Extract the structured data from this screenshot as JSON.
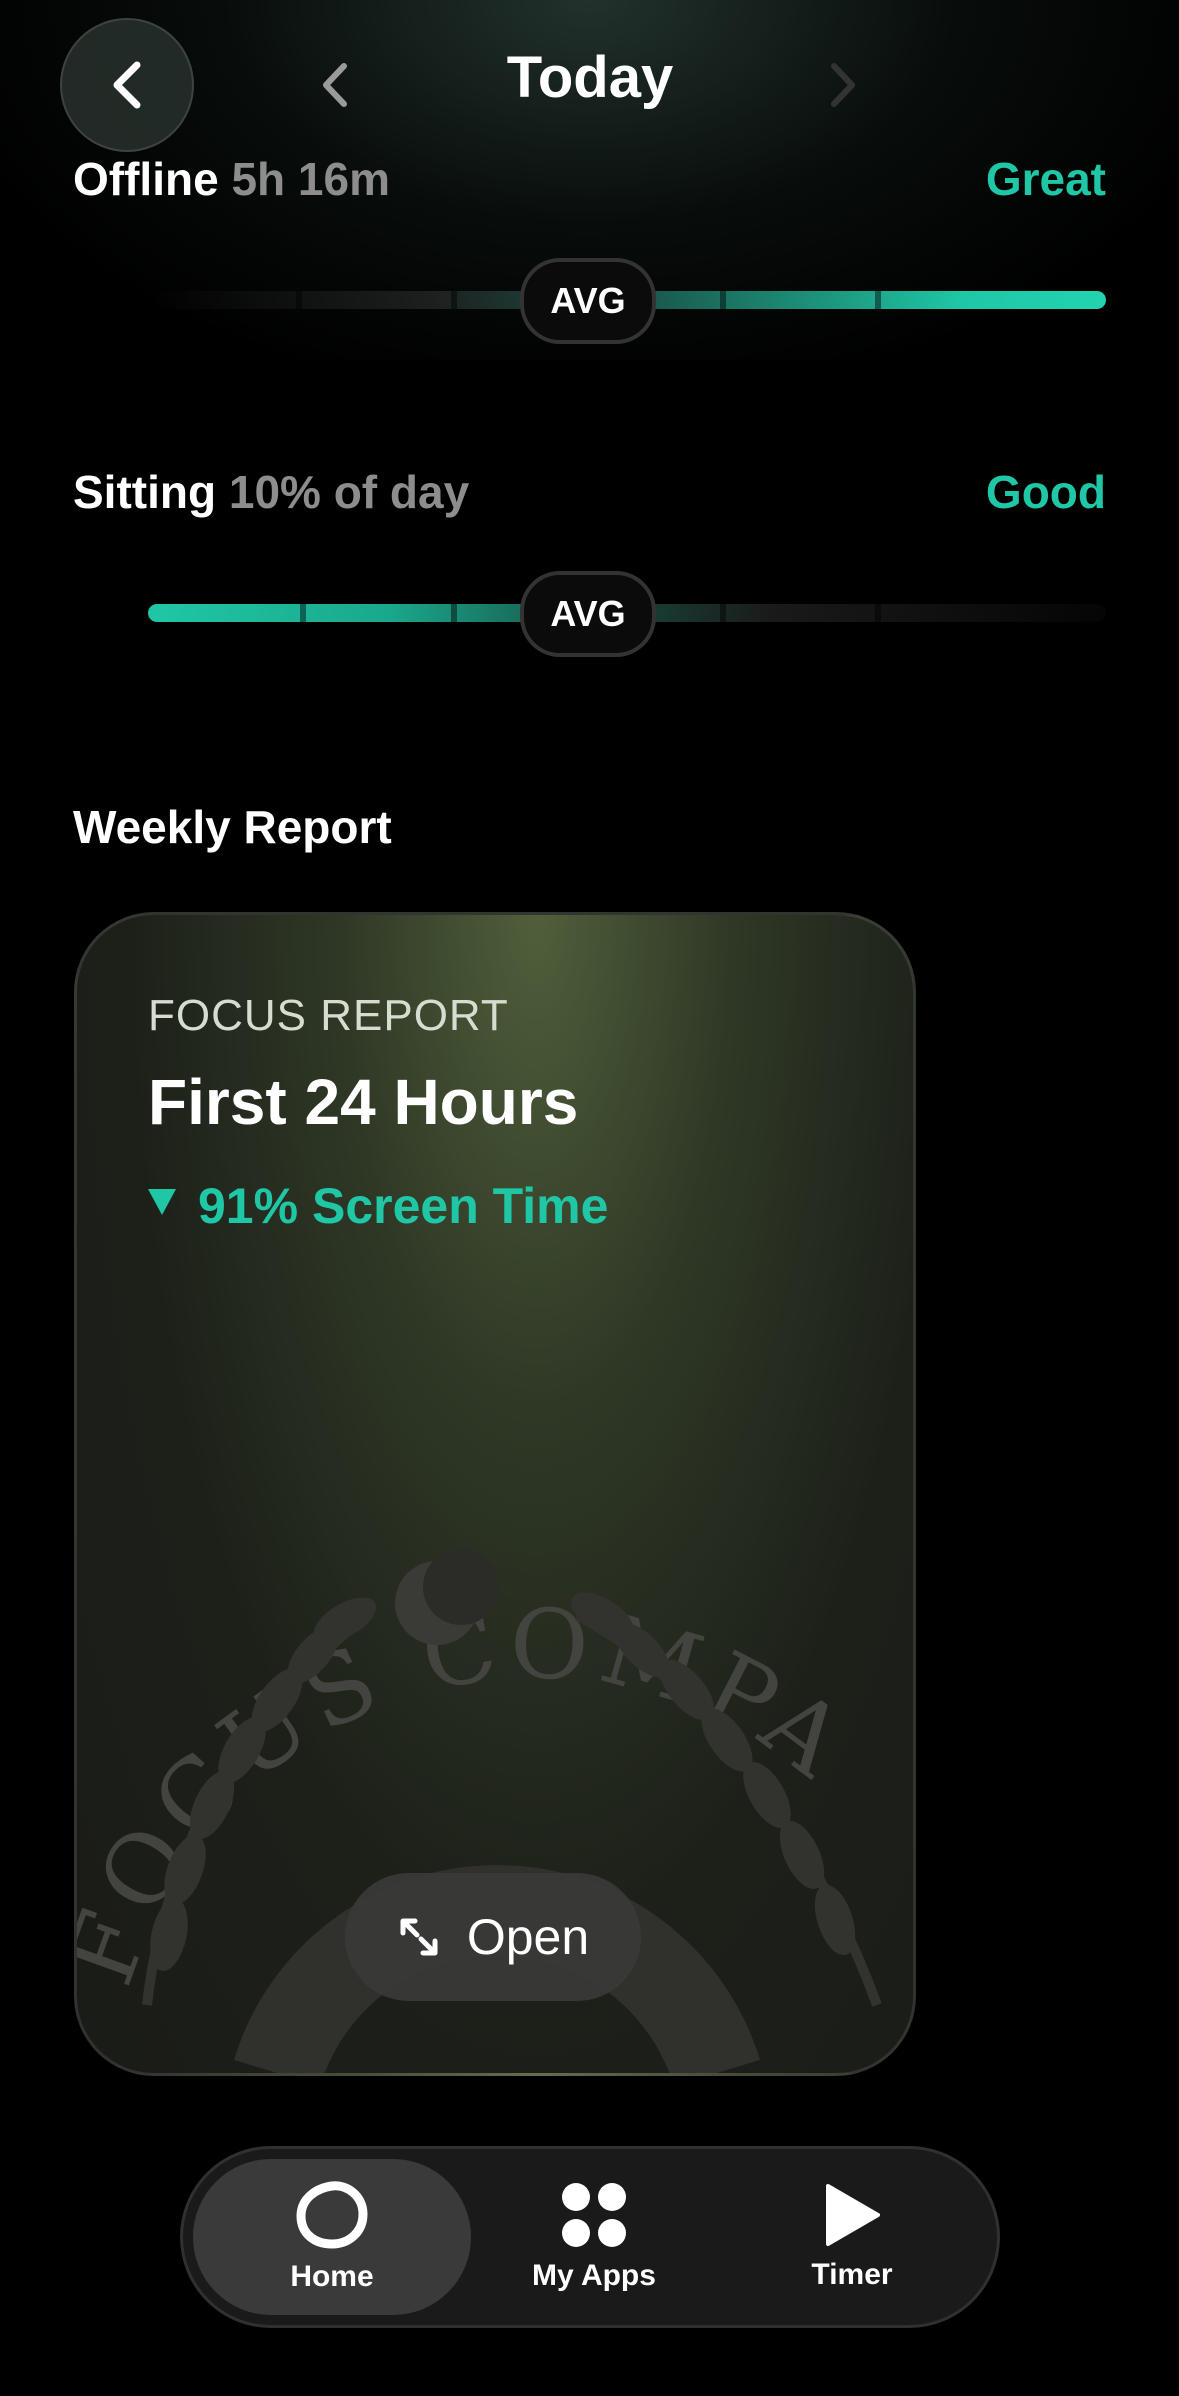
{
  "header": {
    "title": "Today"
  },
  "metrics": [
    {
      "label": "Offline",
      "value": "5h 16m",
      "rating": "Great",
      "marker": "AVG"
    },
    {
      "label": "Sitting",
      "value": "10% of day",
      "rating": "Good",
      "marker": "AVG"
    }
  ],
  "weekly": {
    "section_title": "Weekly Report",
    "card": {
      "eyebrow": "FOCUS REPORT",
      "title": "First 24 Hours",
      "stat": "91% Screen Time",
      "stat_direction": "down",
      "seal_text": "FOCUS COMPA",
      "open_label": "Open"
    }
  },
  "tabs": [
    {
      "label": "Home",
      "icon": "home-blob-icon",
      "active": true
    },
    {
      "label": "My Apps",
      "icon": "apps-grid-icon",
      "active": false
    },
    {
      "label": "Timer",
      "icon": "play-icon",
      "active": false
    }
  ],
  "colors": {
    "accent": "#1fc7a6",
    "background": "#000000",
    "card": "#2a2e24"
  }
}
